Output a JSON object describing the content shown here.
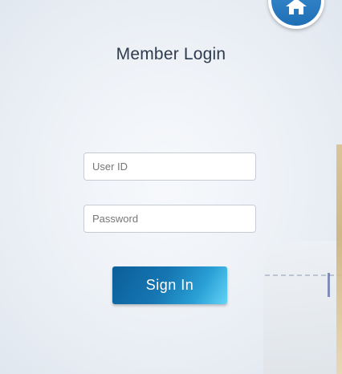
{
  "header": {
    "title": "Member Login",
    "home_icon": "home-icon"
  },
  "form": {
    "user_id": {
      "value": "",
      "placeholder": "User ID"
    },
    "password": {
      "value": "",
      "placeholder": "Password"
    },
    "submit_label": "Sign In"
  },
  "colors": {
    "accent": "#1677b3",
    "title_text": "#2e3b4e",
    "home_button": "#2a7cc4"
  }
}
